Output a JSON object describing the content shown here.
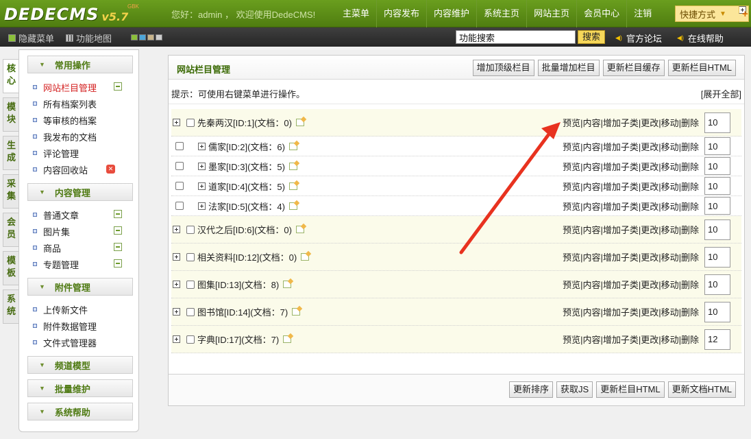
{
  "header": {
    "logo_text": "DEDECMS",
    "logo_version": "v5.7",
    "logo_sup": "GBK",
    "welcome": "您好：admin ， 欢迎使用DedeCMS!",
    "nav": [
      "主菜单",
      "内容发布",
      "内容维护",
      "系统主页",
      "网站主页",
      "会员中心",
      "注销"
    ],
    "quick_menu": "快捷方式"
  },
  "subbar": {
    "hide_menu": "隐藏菜单",
    "function_map": "功能地图",
    "search_value": "功能搜索",
    "search_button": "搜索",
    "forum_link": "官方论坛",
    "help_link": "在线帮助"
  },
  "vtabs": [
    "核心",
    "模块",
    "生成",
    "采集",
    "会员",
    "模板",
    "系统"
  ],
  "sidebar": {
    "sections": [
      {
        "title": "常用操作",
        "items": [
          {
            "label": "网站栏目管理",
            "active": true,
            "icon": "add-icon"
          },
          {
            "label": "所有档案列表"
          },
          {
            "label": "等审核的档案"
          },
          {
            "label": "我发布的文档"
          },
          {
            "label": "评论管理"
          },
          {
            "label": "内容回收站",
            "icon": "delete-icon"
          }
        ]
      },
      {
        "title": "内容管理",
        "items": [
          {
            "label": "普通文章",
            "icon": "add-icon"
          },
          {
            "label": "图片集",
            "icon": "add-icon"
          },
          {
            "label": "商品",
            "icon": "add-icon"
          },
          {
            "label": "专题管理",
            "icon": "add-icon"
          }
        ]
      },
      {
        "title": "附件管理",
        "items": [
          {
            "label": "上传新文件"
          },
          {
            "label": "附件数据管理"
          },
          {
            "label": "文件式管理器"
          }
        ]
      },
      {
        "title": "频道模型",
        "items": []
      },
      {
        "title": "批量维护",
        "items": []
      },
      {
        "title": "系统帮助",
        "items": []
      }
    ]
  },
  "panel": {
    "title": "网站栏目管理",
    "buttons": [
      "增加顶级栏目",
      "批量增加栏目",
      "更新栏目缓存",
      "更新栏目HTML"
    ],
    "tip": "提示：可使用右键菜单进行操作。",
    "expand_all": "[展开全部]",
    "ops_text": "预览|内容|增加子类|更改|移动|删除",
    "rows": [
      {
        "name": "先秦两汉[ID:1](文档：0)",
        "sort": "10",
        "level": "top"
      },
      {
        "name": "儒家[ID:2](文档：6)",
        "sort": "10",
        "level": "child"
      },
      {
        "name": "墨家[ID:3](文档：5)",
        "sort": "10",
        "level": "child"
      },
      {
        "name": "道家[ID:4](文档：5)",
        "sort": "10",
        "level": "child"
      },
      {
        "name": "法家[ID:5](文档：4)",
        "sort": "10",
        "level": "child"
      },
      {
        "name": "汉代之后[ID:6](文档：0)",
        "sort": "10",
        "level": "top"
      },
      {
        "name": "相关资料[ID:12](文档：0)",
        "sort": "10",
        "level": "top"
      },
      {
        "name": "图集[ID:13](文档：8)",
        "sort": "10",
        "level": "top"
      },
      {
        "name": "图书馆[ID:14](文档：7)",
        "sort": "10",
        "level": "top"
      },
      {
        "name": "字典[ID:17](文档：7)",
        "sort": "12",
        "level": "top"
      }
    ],
    "bottom_buttons": [
      "更新排序",
      "获取JS",
      "更新栏目HTML",
      "更新文档HTML"
    ]
  },
  "colors": {
    "brand_green": "#5a8a16",
    "accent_yellow": "#f6d75a",
    "active_red": "#d42121",
    "annotation_arrow": "#e8321f"
  }
}
